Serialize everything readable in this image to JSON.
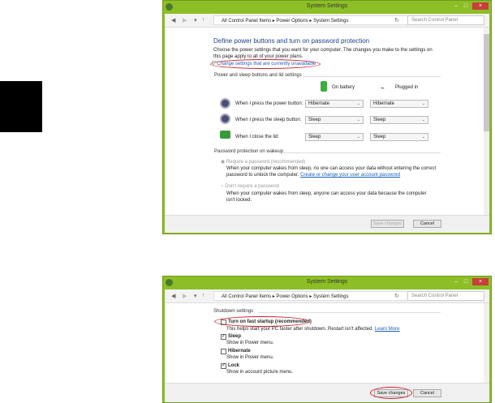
{
  "window1": {
    "title": "System Settings",
    "breadcrumb": [
      "All Control Panel Items",
      "Power Options",
      "System Settings"
    ],
    "search_placeholder": "Search Control Panel",
    "heading": "Define power buttons and turn on password protection",
    "description": "Choose the power settings that you want for your computer. The changes you make to the settings on this page apply to all of your power plans.",
    "change_link": "Change settings that are currently unavailable",
    "section_power": "Power and sleep buttons and lid settings",
    "col_battery": "On battery",
    "col_plugged": "Plugged in",
    "rows": [
      {
        "label": "When I press the power button:",
        "battery": "Hibernate",
        "plugged": "Hibernate"
      },
      {
        "label": "When I press the sleep button:",
        "battery": "Sleep",
        "plugged": "Sleep"
      },
      {
        "label": "When I close the lid:",
        "battery": "Sleep",
        "plugged": "Sleep"
      }
    ],
    "section_password": "Password protection on wakeup",
    "opt_require": "Require a password (recommended)",
    "opt_require_desc": "When your computer wakes from sleep, no one can access your data without entering the correct password to unlock the computer.",
    "opt_require_link": "Create or change your user account password",
    "opt_none": "Don't require a password",
    "opt_none_desc": "When your computer wakes from sleep, anyone can access your data because the computer isn't locked.",
    "save": "Save changes",
    "cancel": "Cancel"
  },
  "window2": {
    "title": "System Settings",
    "breadcrumb": [
      "All Control Panel Items",
      "Power Options",
      "System Settings"
    ],
    "search_placeholder": "Search Control Panel",
    "section_shutdown": "Shutdown settings",
    "items": [
      {
        "label": "Turn on fast startup (recommended)",
        "desc": "This helps start your PC faster after shutdown. Restart isn't affected.",
        "checked": false
      },
      {
        "label": "Sleep",
        "desc": "Show in Power menu.",
        "checked": true
      },
      {
        "label": "Hibernate",
        "desc": "Show in Power menu.",
        "checked": false
      },
      {
        "label": "Lock",
        "desc": "Show in account picture menu.",
        "checked": true
      }
    ],
    "learn_more": "Learn More",
    "save": "Save changes",
    "cancel": "Cancel"
  },
  "colors": {
    "frame": "#8cbf26",
    "highlight": "#d01f2c",
    "link": "#1a5fb4"
  }
}
